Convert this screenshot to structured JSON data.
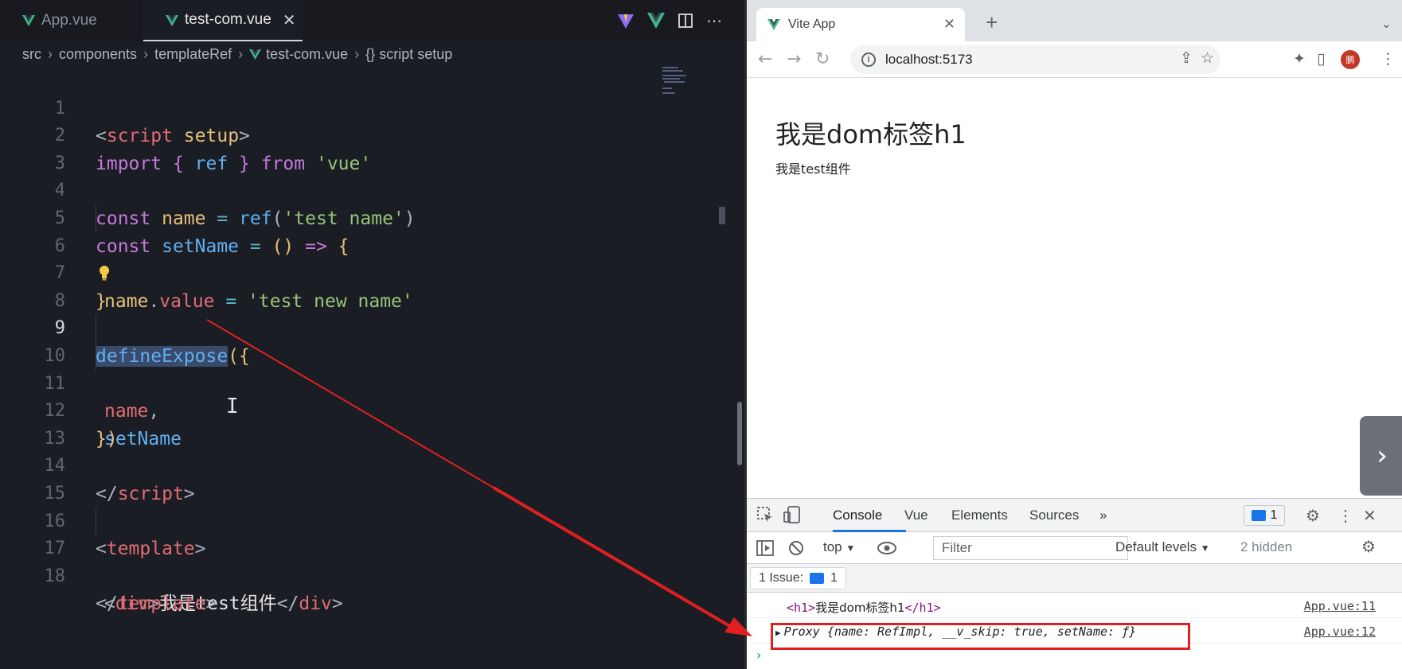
{
  "editor": {
    "tabs": [
      {
        "label": "App.vue",
        "active": false
      },
      {
        "label": "test-com.vue",
        "active": true
      }
    ],
    "close_glyph": "✕",
    "actions": [
      "vite-icon",
      "vue-icon",
      "split-editor-icon",
      "more-icon"
    ],
    "more_glyph": "⋯",
    "breadcrumb": [
      "src",
      "components",
      "templateRef",
      "test-com.vue",
      "{} script setup"
    ],
    "lines": [
      {
        "n": "1"
      },
      {
        "n": "2"
      },
      {
        "n": "3"
      },
      {
        "n": "4"
      },
      {
        "n": "5"
      },
      {
        "n": "6"
      },
      {
        "n": "7"
      },
      {
        "n": "8"
      },
      {
        "n": "9"
      },
      {
        "n": "10"
      },
      {
        "n": "11"
      },
      {
        "n": "12"
      },
      {
        "n": "13"
      },
      {
        "n": "14"
      },
      {
        "n": "15"
      },
      {
        "n": "16"
      },
      {
        "n": "17"
      },
      {
        "n": "18"
      }
    ],
    "code": {
      "l1_open": "<",
      "l1_tag": "script",
      "l1_attr": " setup",
      "l1_close": ">",
      "l2_import": "import",
      "l2_brace_open": " { ",
      "l2_ref": "ref",
      "l2_brace_close": " } ",
      "l2_from": "from",
      "l2_str": " 'vue'",
      "l4_const": "const",
      "l4_name": " name",
      "l4_eq": " = ",
      "l4_ref": "ref",
      "l4_paren": "(",
      "l4_str": "'test name'",
      "l4_paren2": ")",
      "l5_const": "const",
      "l5_fn": " setName",
      "l5_eq": " = ",
      "l5_parens": "()",
      "l5_arrow": " => ",
      "l5_brace": "{",
      "l6_name": "name",
      "l6_dot": ".",
      "l6_value": "value",
      "l6_eq": " = ",
      "l6_str": "'test new name'",
      "l7_brace": "}",
      "l9_define": "defineExpose",
      "l9_open": "({",
      "l10_name": "name",
      "l10_comma": ",",
      "l11_setname": "setName",
      "l12_close": "})",
      "l14_open": "</",
      "l14_tag": "script",
      "l14_close": ">",
      "l16_open": "<",
      "l16_tag": "template",
      "l16_close": ">",
      "l17_open": "<",
      "l17_tag": "div",
      "l17_gt": ">",
      "l17_text": "我是test组件",
      "l17_endopen": "</",
      "l17_endtag": "div",
      "l17_endgt": ">",
      "l18_open": "</",
      "l18_tag": "template",
      "l18_close": ">"
    },
    "active_line": 9,
    "cursor_glyph": "I"
  },
  "browser": {
    "tab_title": "Vite App",
    "tab_close": "✕",
    "new_tab": "+",
    "tab_menu": "⌄",
    "nav": {
      "back": "←",
      "forward": "→",
      "reload": "↻"
    },
    "url": "localhost:5173",
    "info_glyph": "i",
    "toolbar_glyphs": {
      "share": "⇪",
      "star": "☆",
      "extensions": "✦",
      "sidepanel": "▯",
      "menu": "⋮"
    },
    "avatar_text": "鹏",
    "page": {
      "h1": "我是dom标签h1",
      "div": "我是test组件"
    },
    "side_arrow": "›",
    "devtools": {
      "tabs": [
        "Console",
        "Vue",
        "Elements",
        "Sources"
      ],
      "active_tab": "Console",
      "more_tabs": "»",
      "messages_count": "1",
      "context": "top",
      "dropdown_glyph": "▼",
      "filter_placeholder": "Filter",
      "levels": "Default levels",
      "hidden": "2 hidden",
      "issues_label": "1 Issue:",
      "issues_count": "1",
      "console_lines": [
        {
          "tag_open": "<h1>",
          "text": "我是dom标签h1",
          "tag_close": "</h1>",
          "source": "App.vue:11"
        },
        {
          "expander": "▶",
          "text": "Proxy {name: RefImpl, __v_skip: true, setName: ƒ}",
          "source": "App.vue:12"
        }
      ],
      "prompt": "›"
    }
  },
  "colors": {
    "annotation_red": "#e02020",
    "vue_green": "#41b883",
    "editor_bg": "#1b1d24"
  }
}
